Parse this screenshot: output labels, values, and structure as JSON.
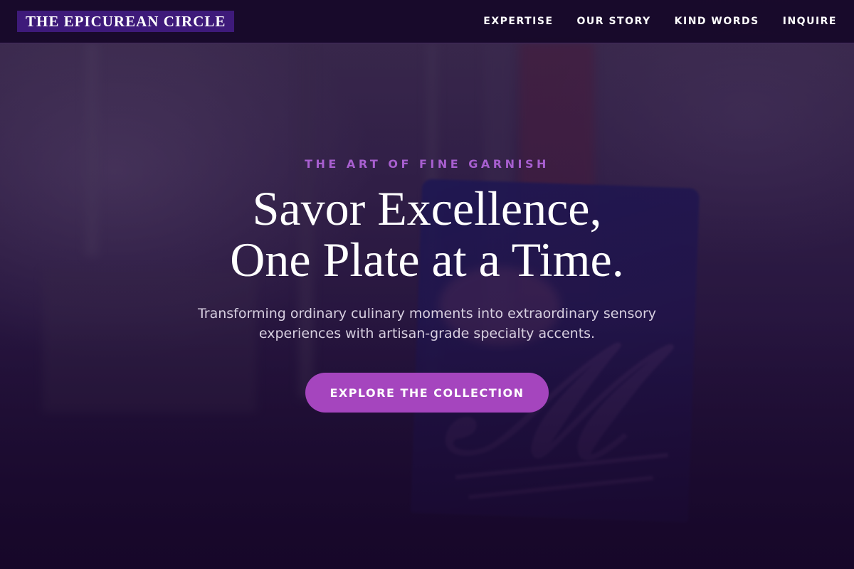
{
  "brand": {
    "name": "THE EPICUREAN CIRCLE"
  },
  "nav": {
    "items": [
      {
        "label": "EXPERTISE"
      },
      {
        "label": "OUR STORY"
      },
      {
        "label": "KIND WORDS"
      },
      {
        "label": "INQUIRE"
      }
    ]
  },
  "hero": {
    "eyebrow": "THE ART OF FINE GARNISH",
    "headline_line1": "Savor Excellence,",
    "headline_line2": "One Plate at a Time.",
    "subtitle_line1": "Transforming ordinary culinary moments into extraordinary sensory",
    "subtitle_line2": "experiences with artisan-grade specialty accents.",
    "cta_label": "EXPLORE THE COLLECTION"
  },
  "colors": {
    "brand_bg": "#3e1a7a",
    "accent": "#a545be",
    "eyebrow": "#a85fd0",
    "header_bg": "#160828"
  }
}
